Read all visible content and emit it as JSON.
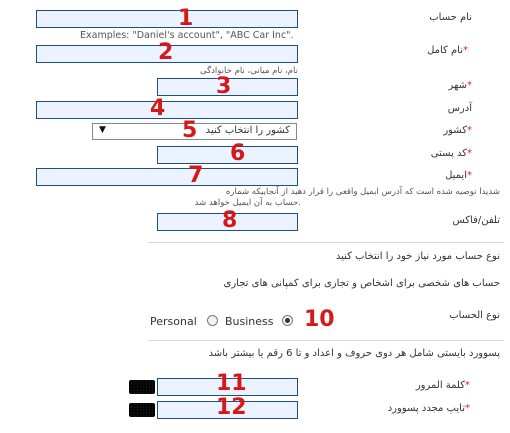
{
  "fields": {
    "account_name": {
      "label": "نام حساب",
      "number": "1",
      "hint": "Examples: \"Daniel's account\", \"ABC Car Inc\"."
    },
    "full_name": {
      "label": "نام کامل",
      "required": "*",
      "number": "2",
      "hint": "نام، نام میانی، نام خانوادگی"
    },
    "city": {
      "label": "شهر",
      "required": "*",
      "number": "3"
    },
    "address": {
      "label": "آدرس",
      "number": "4"
    },
    "country": {
      "label": "کشور",
      "required": "*",
      "number": "5",
      "selected": "کشور را انتخاب کنید",
      "arrow": "▼"
    },
    "postal_code": {
      "label": "کد پستی",
      "required": "*",
      "number": "6"
    },
    "email": {
      "label": "ایمیل",
      "required": "*",
      "number": "7",
      "hint_line1": "شدیدا توصیه شده است که آدرس ایمیل واقعی را قرار دهید از آنجاییکه شماره",
      "hint_line2": "حساب به آن ایمیل خواهد شد."
    },
    "phone": {
      "label": "تلفن/فاکس",
      "number": "8"
    }
  },
  "account_type": {
    "heading": "نوع حساب مورد نیاز خود را انتخاب کنید",
    "description": "حساب های شخصی برای اشخاص و تجاری برای کمپانی های تجاری",
    "label": "نوع الحساب",
    "number": "10",
    "options": [
      {
        "label": "Personal",
        "selected": false
      },
      {
        "label": "Business",
        "selected": true
      }
    ]
  },
  "password": {
    "rule": "پسوورد بایستی شامل هر دوی حروف و اعداد و تا 6 رقم یا بیشتر باشد",
    "password_label": "کلمة المرور",
    "password_required": "*",
    "password_number": "11",
    "confirm_label": "تایپ مجدد پسوورد",
    "confirm_required": "*",
    "confirm_number": "12"
  }
}
